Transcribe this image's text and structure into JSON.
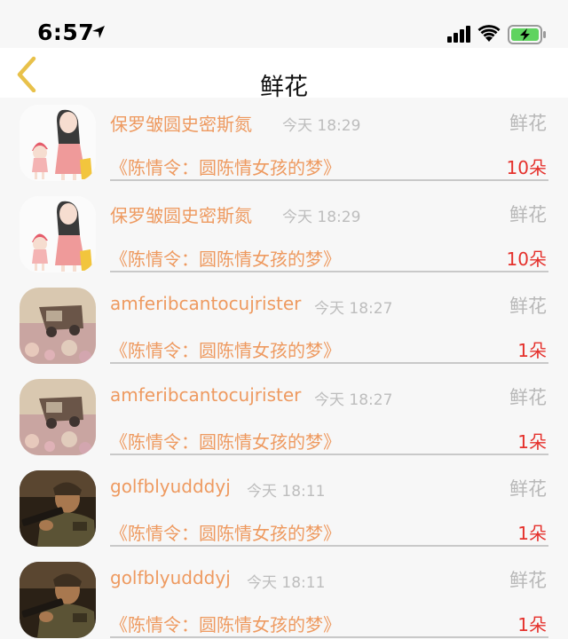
{
  "status_bar": {
    "time": "6:57"
  },
  "nav": {
    "title": "鲜花"
  },
  "colors": {
    "accent_orange": "#ee9a60",
    "count_red": "#e5312c",
    "back_arrow": "#e8c14a",
    "battery_green": "#5fd35f"
  },
  "rows": [
    {
      "avatar": "girl-cartoon-avatar",
      "sender": "保罗皱圆史密斯氮",
      "time": "今天 18:29",
      "gift": "鲜花",
      "article": "《陈情令：圆陈情女孩的梦》",
      "count": "10朵"
    },
    {
      "avatar": "girl-cartoon-avatar",
      "sender": "保罗皱圆史密斯氮",
      "time": "今天 18:29",
      "gift": "鲜花",
      "article": "《陈情令：圆陈情女孩的梦》",
      "count": "10朵"
    },
    {
      "avatar": "vintage-truck-avatar",
      "sender": "amferibcantocujrister",
      "time": "今天 18:27",
      "gift": "鲜花",
      "article": "《陈情令：圆陈情女孩的梦》",
      "count": "1朵"
    },
    {
      "avatar": "vintage-truck-avatar",
      "sender": "amferibcantocujrister",
      "time": "今天 18:27",
      "gift": "鲜花",
      "article": "《陈情令：圆陈情女孩的梦》",
      "count": "1朵"
    },
    {
      "avatar": "soldier-game-avatar",
      "sender": "golfblyudddyj",
      "time": "今天 18:11",
      "gift": "鲜花",
      "article": "《陈情令：圆陈情女孩的梦》",
      "count": "1朵"
    },
    {
      "avatar": "soldier-game-avatar",
      "sender": "golfblyudddyj",
      "time": "今天 18:11",
      "gift": "鲜花",
      "article": "《陈情令：圆陈情女孩的梦》",
      "count": "1朵"
    }
  ]
}
